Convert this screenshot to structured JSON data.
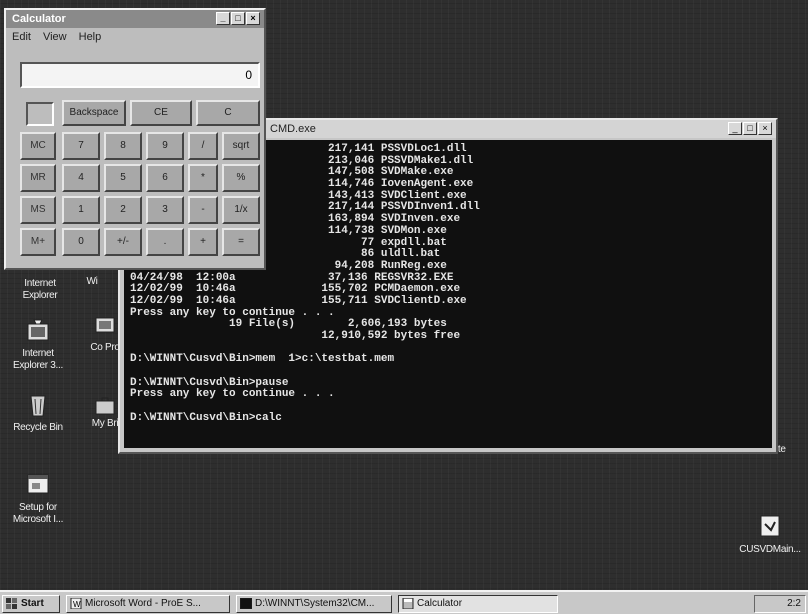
{
  "desktop_icons": [
    {
      "label": "Internet Explorer"
    },
    {
      "label": "Internet Explorer 3..."
    },
    {
      "label": "Recycle Bin"
    },
    {
      "label": "Setup for Microsoft I..."
    },
    {
      "label": "Distribute"
    },
    {
      "label": "CUSVDMain..."
    },
    {
      "label": "Wi"
    },
    {
      "label": "Co Pro"
    },
    {
      "label": "My Bri"
    }
  ],
  "cmd_window": {
    "title": "CMD.exe",
    "lines": [
      "                              217,141 PSSVDLoc1.dll",
      "                              213,046 PSSVDMake1.dll",
      "                              147,508 SVDMake.exe",
      "                              114,746 IovenAgent.exe",
      "                              143,413 SVDClient.exe",
      "                              217,144 PSSVDInven1.dll",
      "                              163,894 SVDInven.exe",
      "                              114,738 SVDMon.exe",
      "                                   77 expdll.bat",
      "                                   86 uldll.bat",
      "                               94,208 RunReg.exe",
      "04/24/98  12:00a              37,136 REGSVR32.EXE",
      "12/02/99  10:46a             155,702 PCMDaemon.exe",
      "12/02/99  10:46a             155,711 SVDClientD.exe",
      "Press any key to continue . . .",
      "               19 File(s)        2,606,193 bytes",
      "                             12,910,592 bytes free",
      "",
      "D:\\WINNT\\Cusvd\\Bin>mem  1>c:\\testbat.mem",
      "",
      "D:\\WINNT\\Cusvd\\Bin>pause",
      "Press any key to continue . . .",
      "",
      "D:\\WINNT\\Cusvd\\Bin>calc"
    ]
  },
  "calculator": {
    "title": "Calculator",
    "menu": [
      "Edit",
      "View",
      "Help"
    ],
    "display": "0",
    "top_buttons": [
      "Backspace",
      "CE",
      "C"
    ],
    "keypad": [
      [
        "MC",
        "7",
        "8",
        "9",
        "/",
        "sqrt"
      ],
      [
        "MR",
        "4",
        "5",
        "6",
        "*",
        "%"
      ],
      [
        "MS",
        "1",
        "2",
        "3",
        "-",
        "1/x"
      ],
      [
        "M+",
        "0",
        "+/-",
        ".",
        "+",
        "="
      ]
    ]
  },
  "taskbar": {
    "start": "Start",
    "tasks": [
      {
        "label": "Microsoft Word - ProE S..."
      },
      {
        "label": "D:\\WINNT\\System32\\CM..."
      },
      {
        "label": "Calculator"
      }
    ],
    "clock": "2:2"
  },
  "colors": {
    "desktop": "#2e2e2e",
    "console_bg": "#101010",
    "console_fg": "#e6e6e6",
    "window_face": "#c6c6c6"
  }
}
